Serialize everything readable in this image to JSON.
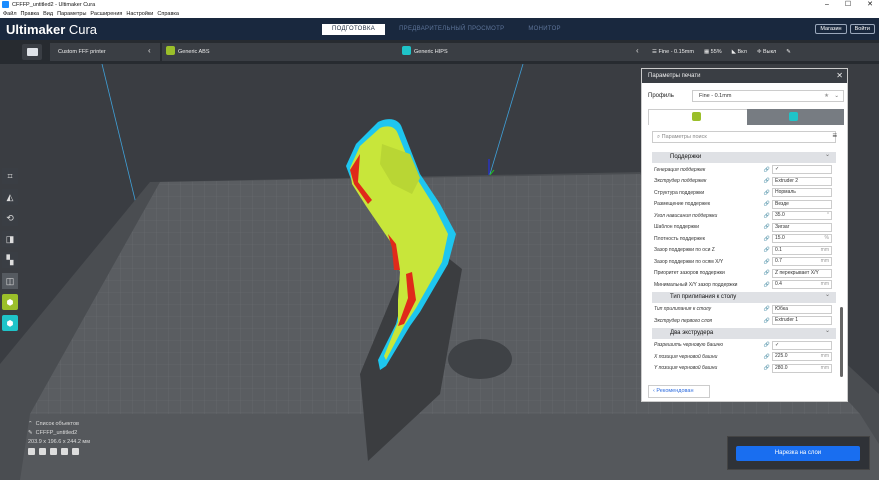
{
  "window": {
    "title": "CFFFP_untitled2 - Ultimaker Cura",
    "controls": [
      "–",
      "☐",
      "✕"
    ]
  },
  "menu": [
    "Файл",
    "Правка",
    "Вид",
    "Параметры",
    "Расширения",
    "Настройки",
    "Справка"
  ],
  "header": {
    "logo_bold": "Ultimaker",
    "logo_light": " Cura",
    "stages": [
      "ПОДГОТОВКА",
      "ПРЕДВАРИТЕЛЬНЫЙ ПРОСМОТР",
      "МОНИТОР"
    ],
    "active_stage": "ПОДГОТОВКА",
    "right_buttons": [
      "Магазин",
      "Войти"
    ]
  },
  "printer_bar": {
    "printer": "Custom FFF printer",
    "material1": "Generic ABS",
    "material2": "Generic HIPS",
    "profile": "Fine - 0.15mm",
    "infill": "55%",
    "support": "Вкл",
    "adhesion": "Выкл"
  },
  "colors": {
    "extruder1": "#9bbf2a",
    "extruder2": "#1fc4c9",
    "header": "#19283e",
    "accent": "#196ef0"
  },
  "objects": {
    "title": "Список объектов",
    "name": "CFFFP_untitled2",
    "dims": "203.9 x 196.6 x 244.2 мм"
  },
  "panel": {
    "title": "Параметры печати",
    "profile_label": "Профиль",
    "profile_value": "Fine - 0.1mm",
    "search_placeholder": "Параметры поиск",
    "recommended": "Рекомендован",
    "categories": [
      "Поддержки",
      "Тип прилипания к столу",
      "Два экструдера"
    ],
    "support_rows": [
      {
        "name": "Генерация поддержек",
        "value": "✓",
        "unit": ""
      },
      {
        "name": "Экструдер поддержек",
        "value": "Extruder 2",
        "unit": ""
      },
      {
        "name": "Структура поддержки",
        "value": "Нормаль",
        "unit": ""
      },
      {
        "name": "Размещение поддержек",
        "value": "Везде",
        "unit": ""
      },
      {
        "name": "Угол нависания поддержки",
        "value": "35.0",
        "unit": "°"
      },
      {
        "name": "Шаблон поддержки",
        "value": "Зигзаг",
        "unit": ""
      },
      {
        "name": "Плотность поддержек",
        "value": "15.0",
        "unit": "%"
      },
      {
        "name": "Зазор поддержки по оси Z",
        "value": "0.1",
        "unit": "mm"
      },
      {
        "name": "Зазор поддержки по осям X/Y",
        "value": "0.7",
        "unit": "mm"
      },
      {
        "name": "Приоритет зазоров поддержки",
        "value": "Z перекрывает X/Y",
        "unit": ""
      },
      {
        "name": "Минимальный X/Y зазор поддержки",
        "value": "0.4",
        "unit": "mm"
      }
    ],
    "adhesion_rows": [
      {
        "name": "Тип прилипания к столу",
        "value": "Юбка",
        "unit": ""
      },
      {
        "name": "Экструдер первого слоя",
        "value": "Extruder 1",
        "unit": ""
      }
    ],
    "dual_rows": [
      {
        "name": "Разрешить черновую башню",
        "value": "✓",
        "unit": ""
      },
      {
        "name": "X позиция черновой башни",
        "value": "225.0",
        "unit": "mm"
      },
      {
        "name": "Y позиция черновой башни",
        "value": "280.0",
        "unit": "mm"
      }
    ]
  },
  "slice": {
    "button": "Нарезка на слои"
  }
}
